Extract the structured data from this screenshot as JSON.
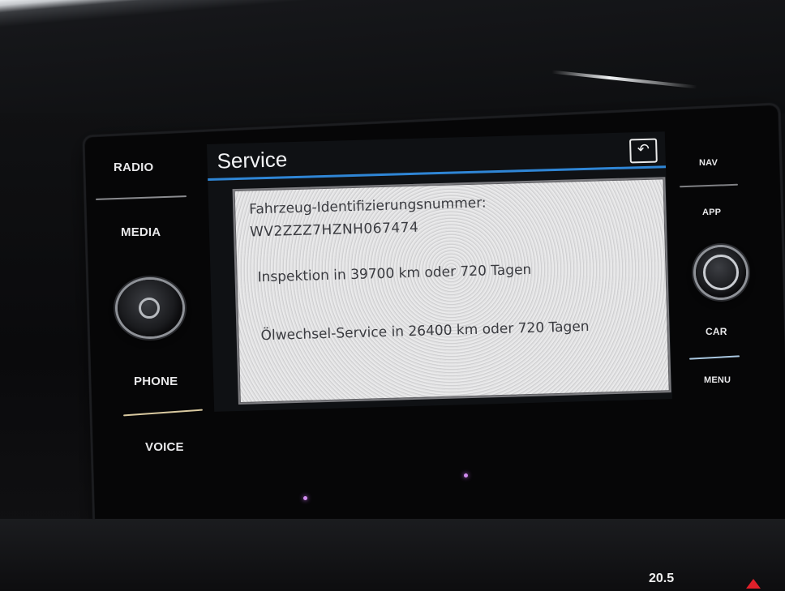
{
  "left_buttons": {
    "radio": "RADIO",
    "media": "MEDIA",
    "phone": "PHONE",
    "voice": "VOICE"
  },
  "right_buttons": {
    "nav": "NAV",
    "app": "APP",
    "car": "CAR",
    "menu": "MENU"
  },
  "screen": {
    "title": "Service",
    "back_icon": "back-arrow-icon",
    "accent_color": "#2f86d6",
    "info": {
      "vin_label": "Fahrzeug-Identifizierungsnummer:",
      "vin_value": "WV2ZZZ7HZNH067474",
      "inspection": "Inspektion in 39700 km oder 720 Tagen",
      "oil_service": "Ölwechsel-Service in 26400 km oder 720 Tagen"
    }
  },
  "climate": {
    "display": "20.5"
  }
}
